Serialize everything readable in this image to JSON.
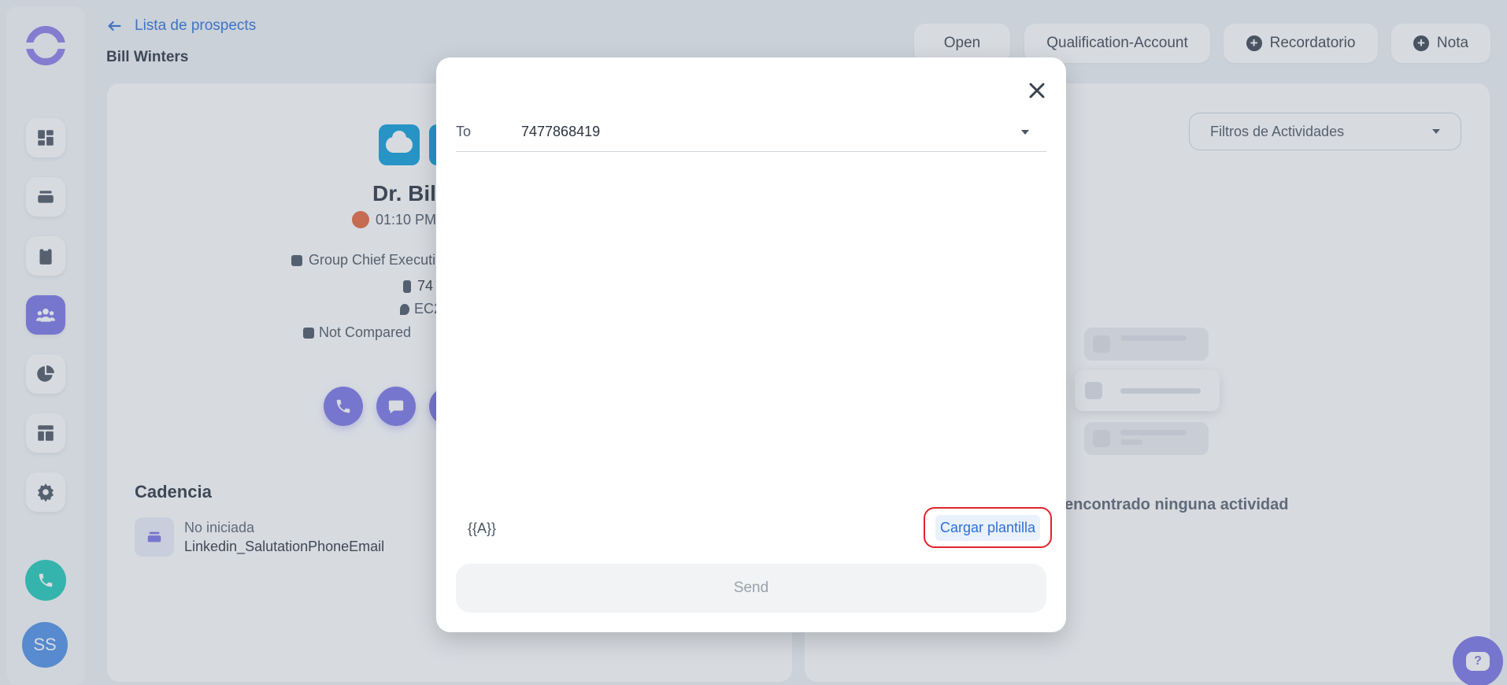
{
  "header": {
    "back_label": "Lista de prospects",
    "prospect_name": "Bill Winters",
    "stage_chip": "Open",
    "status_chip": "Qualification-Account",
    "reminder_chip": "Recordatorio",
    "note_chip": "Nota"
  },
  "sidebar": {
    "items": [
      {
        "icon": "dashboard-icon"
      },
      {
        "icon": "stack-icon"
      },
      {
        "icon": "clipboard-icon"
      },
      {
        "icon": "people-icon",
        "active": true
      },
      {
        "icon": "pie-chart-icon"
      },
      {
        "icon": "layout-icon"
      },
      {
        "icon": "gear-icon"
      }
    ],
    "avatar_initials": "SS"
  },
  "contact": {
    "name_partial": "Dr. Bil",
    "time_partial": "01:10 PM",
    "job_partial": "Group Chief Executi",
    "phone_partial": "74",
    "location_partial": "EC2",
    "compare_label": "Not Compared"
  },
  "cadence": {
    "title": "Cadencia",
    "status": "No iniciada",
    "name": "Linkedin_SalutationPhoneEmail"
  },
  "activities": {
    "filter_label": "Filtros de Actividades",
    "empty_text": "encontrado ninguna actividad"
  },
  "modal": {
    "to_label": "To",
    "to_value": "7477868419",
    "variable_button": "{{A}}",
    "template_button": "Cargar plantilla",
    "send_button": "Send",
    "message_value": ""
  },
  "colors": {
    "accent": "#7b73e6",
    "link": "#2f6fd6",
    "highlight_border": "#e0242b",
    "phone_button": "#1ec9b7"
  }
}
